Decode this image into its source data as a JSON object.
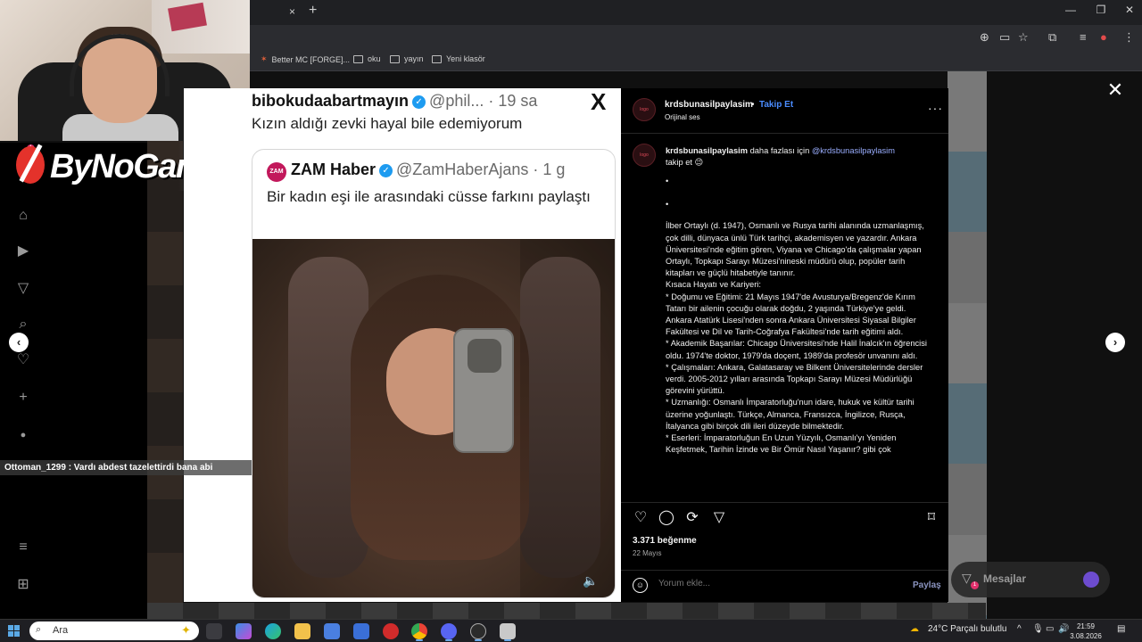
{
  "browser": {
    "close_tab": "×",
    "new_tab": "+",
    "bookmarks": [
      {
        "label": "Better MC [FORGE]..."
      },
      {
        "label": "oku"
      },
      {
        "label": "yayın"
      },
      {
        "label": "Yeni klasör"
      }
    ]
  },
  "stream": {
    "logo_text": "ByNoGame",
    "chat_message": "Ottoman_1299 : Vardı abdest tazelettirdi bana abi"
  },
  "sidebar": {
    "notification_badge": "1"
  },
  "media": {
    "tweet": {
      "name": "bibokudaabartmayın",
      "handle": "@phil...",
      "time": "· 19 sa",
      "text": "Kızın aldığı zevki hayal bile edemiyorum"
    },
    "quote": {
      "logo_text": "ZAM",
      "name": "ZAM Haber",
      "handle": "@ZamHaberAjans",
      "time": "· 1 g",
      "text": "Bir kadın eşi ile arasındaki cüsse farkını paylaştı"
    }
  },
  "post": {
    "username": "krdsbunasilpaylasim",
    "dot": "•",
    "follow_label": "Takip Et",
    "audio_label": "Orijinal ses",
    "caption": {
      "username": "krdsbunasilpaylasim",
      "intro": " daha fazlası için ",
      "mention": "@krdsbunasilpaylasim",
      "intro_end": "takip et 😉",
      "bullet1": "•",
      "bullet2": "•",
      "body": "İlber Ortaylı (d. 1947), Osmanlı ve Rusya tarihi alanında uzmanlaşmış, çok dilli, dünyaca ünlü Türk tarihçi, akademisyen ve yazardır. Ankara Üniversitesi'nde eğitim gören, Viyana ve Chicago'da çalışmalar yapan Ortaylı, Topkapı Sarayı Müzesi'nineski müdürü olup, popüler tarih kitapları ve güçlü hitabetiyle tanınır.",
      "heading": "Kısaca Hayatı ve Kariyeri:",
      "items": [
        "* Doğumu ve Eğitimi: 21 Mayıs 1947'de Avusturya/Bregenz'de Kırım Tatarı bir ailenin çocuğu olarak doğdu, 2 yaşında Türkiye'ye geldi. Ankara Atatürk Lisesi'nden sonra Ankara Üniversitesi Siyasal Bilgiler Fakültesi ve Dil ve Tarih-Coğrafya Fakültesi'nde tarih eğitimi aldı.",
        "* Akademik Başarılar: Chicago Üniversitesi'nde Halil İnalcık'ın öğrencisi oldu. 1974'te doktor, 1979'da doçent, 1989'da profesör unvanını aldı.",
        "* Çalışmaları: Ankara, Galatasaray ve Bilkent Üniversitelerinde dersler verdi. 2005-2012 yılları arasında Topkapı Sarayı Müzesi Müdürlüğü görevini yürüttü.",
        "* Uzmanlığı: Osmanlı İmparatorluğu'nun idare, hukuk ve kültür tarihi üzerine yoğunlaştı. Türkçe, Almanca, Fransızca, İngilizce, Rusça, İtalyanca gibi birçok dili ileri düzeyde bilmektedir.",
        "* Eserleri: İmparatorluğun En Uzun Yüzyılı, Osmanlı'yı Yeniden Keşfetmek, Tarihin İzinde ve Bir Ömür Nasıl Yaşanır? gibi çok"
      ]
    },
    "likes": "3.371 beğenme",
    "date": "22 Mayıs",
    "comment_placeholder": "Yorum ekle...",
    "share_label": "Paylaş"
  },
  "messages": {
    "label": "Mesajlar",
    "badge": "1"
  },
  "taskbar": {
    "search_label": "Ara",
    "weather": "24°C  Parçalı bulutlu",
    "time": "21:59",
    "date": "3.08.2026"
  },
  "colors": {
    "accent_link": "#4a8cff",
    "badge": "#e1306c",
    "logo_red": "#e4322b",
    "zam_brand": "#c2185b",
    "verified": "#1d9bf0"
  }
}
